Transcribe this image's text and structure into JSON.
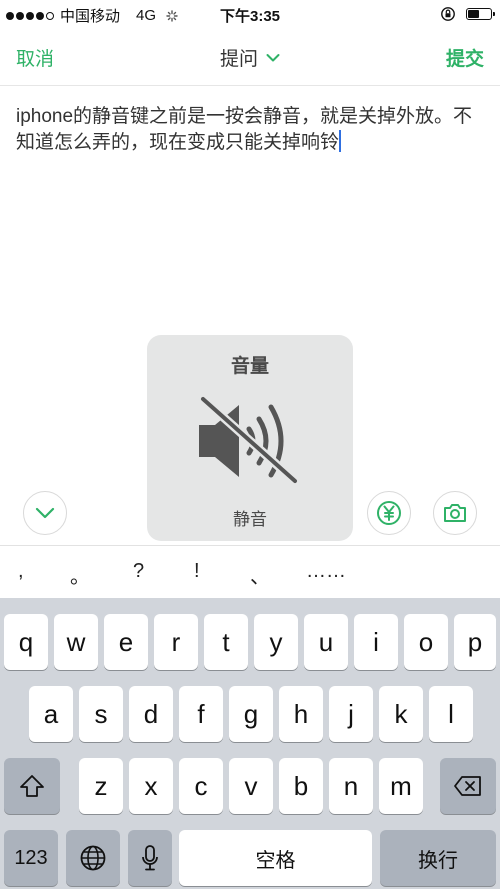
{
  "status_bar": {
    "carrier": "中国移动",
    "network": "4G",
    "time": "下午3:35"
  },
  "nav": {
    "cancel": "取消",
    "title": "提问",
    "submit": "提交"
  },
  "editor": {
    "text": "iphone的静音键之前是一按会静音，就是关掉外放。不知道怎么弄的，现在变成只能关掉响铃"
  },
  "volume_hud": {
    "title": "音量",
    "state": "静音",
    "icon": "speaker-muted-icon"
  },
  "toolbar": {
    "icons": [
      "chevron-down-icon",
      "yuan-icon",
      "camera-icon"
    ]
  },
  "punctuation": [
    ",",
    "。",
    "?",
    "!",
    "、",
    "……"
  ],
  "keyboard": {
    "row1": [
      "q",
      "w",
      "e",
      "r",
      "t",
      "y",
      "u",
      "i",
      "o",
      "p"
    ],
    "row2": [
      "a",
      "s",
      "d",
      "f",
      "g",
      "h",
      "j",
      "k",
      "l"
    ],
    "row3": [
      "z",
      "x",
      "c",
      "v",
      "b",
      "n",
      "m"
    ],
    "numbers_key": "123",
    "space_key": "空格",
    "return_key": "换行",
    "shift_icon": "shift-icon",
    "backspace_icon": "backspace-icon",
    "globe_icon": "globe-icon",
    "mic_icon": "microphone-icon"
  },
  "colors": {
    "accent": "#2fb267",
    "caret": "#2f6fe0",
    "keyboard_bg": "#d1d5db"
  }
}
